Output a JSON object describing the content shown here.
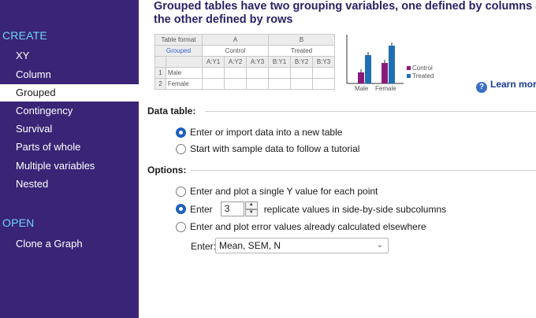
{
  "sidebar": {
    "create_header": "CREATE",
    "create_items": [
      {
        "label": "XY"
      },
      {
        "label": "Column"
      },
      {
        "label": "Grouped",
        "selected": true
      },
      {
        "label": "Contingency"
      },
      {
        "label": "Survival"
      },
      {
        "label": "Parts of whole"
      },
      {
        "label": "Multiple variables"
      },
      {
        "label": "Nested"
      }
    ],
    "open_header": "OPEN",
    "open_items": [
      {
        "label": "Clone a Graph"
      }
    ]
  },
  "headline": {
    "line1": "Grouped tables have two grouping variables, one defined by columns and",
    "line2": "the other defined by rows"
  },
  "illustration": {
    "table": {
      "format_label": "Table format",
      "format_value": "Grouped",
      "group_a": "A",
      "group_b": "B",
      "a_name": "Control",
      "b_name": "Treated",
      "subcolumns": [
        "A:Y1",
        "A:Y2",
        "A:Y3",
        "B:Y1",
        "B:Y2",
        "B:Y3"
      ],
      "rows": [
        {
          "num": "1",
          "name": "Male"
        },
        {
          "num": "2",
          "name": "Female"
        }
      ]
    },
    "mini_chart": {
      "categories": [
        "Male",
        "Female"
      ],
      "legend": [
        "Control",
        "Treated"
      ],
      "colors": {
        "control": "#8a1a7a",
        "treated": "#1f6fb5"
      }
    }
  },
  "learn_more": "Learn more",
  "data_table": {
    "title": "Data table:",
    "options": [
      {
        "label": "Enter or import data into a new table",
        "checked": true
      },
      {
        "label": "Start with sample data to follow a tutorial",
        "checked": false
      }
    ]
  },
  "options": {
    "title": "Options:",
    "single_y": "Enter and plot a single Y value for each point",
    "replicate_prefix": "Enter",
    "replicate_value": "3",
    "replicate_suffix": "replicate values in side-by-side subcolumns",
    "error_values": "Enter and plot error values already calculated elsewhere",
    "enter_label": "Enter:",
    "enter_select": "Mean, SEM, N"
  }
}
